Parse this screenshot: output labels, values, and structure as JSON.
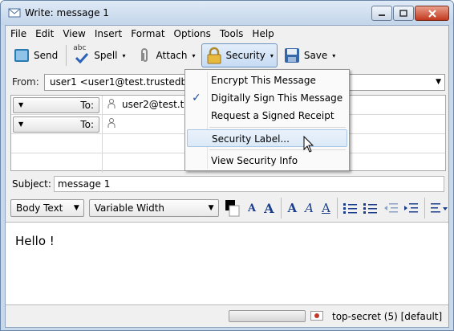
{
  "window": {
    "title": "Write: message 1",
    "min_icon": "minimize-icon",
    "max_icon": "maximize-icon",
    "close_icon": "close-icon"
  },
  "menubar": {
    "items": [
      "File",
      "Edit",
      "View",
      "Insert",
      "Format",
      "Options",
      "Tools",
      "Help"
    ]
  },
  "toolbar": {
    "send_label": "Send",
    "spell_label": "Spell",
    "spell_badge": "abc",
    "attach_label": "Attach",
    "security_label": "Security",
    "save_label": "Save"
  },
  "from": {
    "label": "From:",
    "value": "user1 <user1@test.trustedbird.o"
  },
  "addressing": {
    "rows": [
      {
        "type": "To:",
        "value": "user2@test.trus"
      },
      {
        "type": "To:",
        "value": ""
      }
    ]
  },
  "subject": {
    "label": "Subject:",
    "value": "message 1"
  },
  "format": {
    "paragraph_style": "Body Text",
    "font": "Variable Width",
    "buttons": [
      "A",
      "A",
      "A",
      "A",
      "A"
    ]
  },
  "body": {
    "text": "Hello !"
  },
  "status": {
    "security": "top-secret (5) [default]"
  },
  "security_menu": {
    "items": [
      {
        "label": "Encrypt This Message",
        "checked": false
      },
      {
        "label": "Digitally Sign This Message",
        "checked": true
      },
      {
        "label": "Request a Signed Receipt",
        "checked": false
      },
      {
        "label": "Security Label...",
        "checked": false,
        "highlighted": true
      },
      {
        "label": "View Security Info",
        "checked": false
      }
    ],
    "check_glyph": "✓"
  },
  "colors": {
    "accent": "#1a3e8c",
    "highlight": "#dbe9f7",
    "titlebar": "#c9d9ec"
  }
}
